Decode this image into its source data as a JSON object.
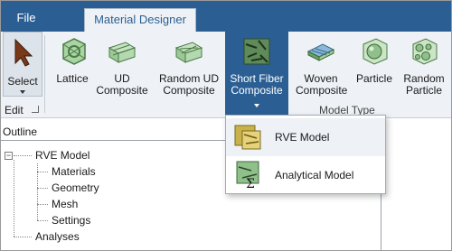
{
  "tabs": {
    "file": "File",
    "material_designer": "Material Designer"
  },
  "ribbon": {
    "select": "Select",
    "edit_group": "Edit",
    "tools": {
      "lattice": "Lattice",
      "ud_composite": [
        "UD",
        "Composite"
      ],
      "random_ud_composite": [
        "Random UD",
        "Composite"
      ],
      "short_fiber_composite": [
        "Short Fiber",
        "Composite"
      ],
      "woven_composite": [
        "Woven",
        "Composite"
      ],
      "particle": "Particle",
      "random_particle": [
        "Random",
        "Particle"
      ]
    },
    "model_type_group": "Model Type"
  },
  "outline": {
    "header": "Outline",
    "root": "RVE Model",
    "children": [
      "Materials",
      "Geometry",
      "Mesh",
      "Settings"
    ],
    "analyses": "Analyses"
  },
  "dropdown": {
    "items": [
      "RVE Model",
      "Analytical Model"
    ]
  },
  "colors": {
    "accent": "#2b5f93",
    "ribbon_bg": "#eef2f6",
    "icon_green": "#8fbf8a"
  }
}
